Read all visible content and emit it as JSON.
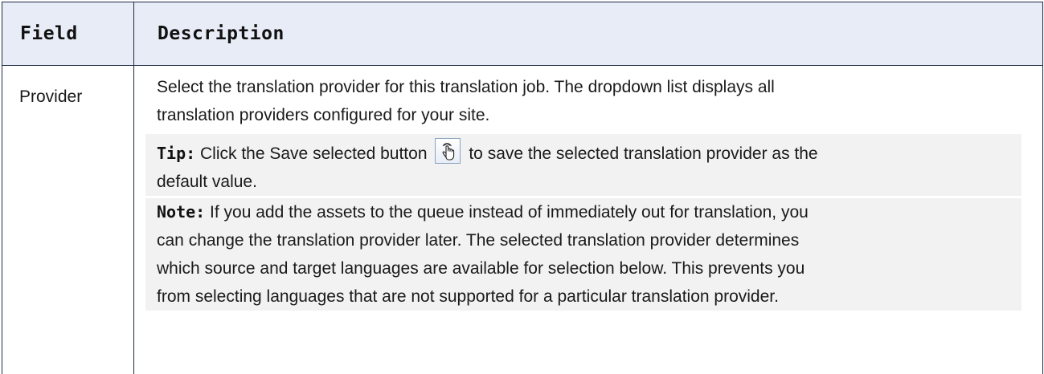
{
  "table": {
    "headers": {
      "field": "Field",
      "description": "Description"
    },
    "rows": [
      {
        "field": "Provider",
        "description_line1": "Select the translation provider for this translation job. The dropdown list displays all",
        "description_line2": "translation providers configured for your site.",
        "tip": {
          "label": "Tip:",
          "text_before_icon": " Click the Save selected button ",
          "text_after_icon": "to save the selected translation provider as the",
          "text_line2": "default value.",
          "icon": "pointing-hand-icon"
        },
        "note": {
          "label": "Note:",
          "line1": " If you add the assets to the queue instead of immediately out for translation, you",
          "line2": "can change the translation provider later. The selected translation provider determines",
          "line3": "which source and target languages are available for selection below. This prevents you",
          "line4": "from selecting languages that are not supported for a particular translation provider."
        }
      }
    ]
  },
  "colors": {
    "header_background": "#e8ecf6",
    "border": "#1f2a44",
    "callout_background": "#f2f2f2"
  }
}
